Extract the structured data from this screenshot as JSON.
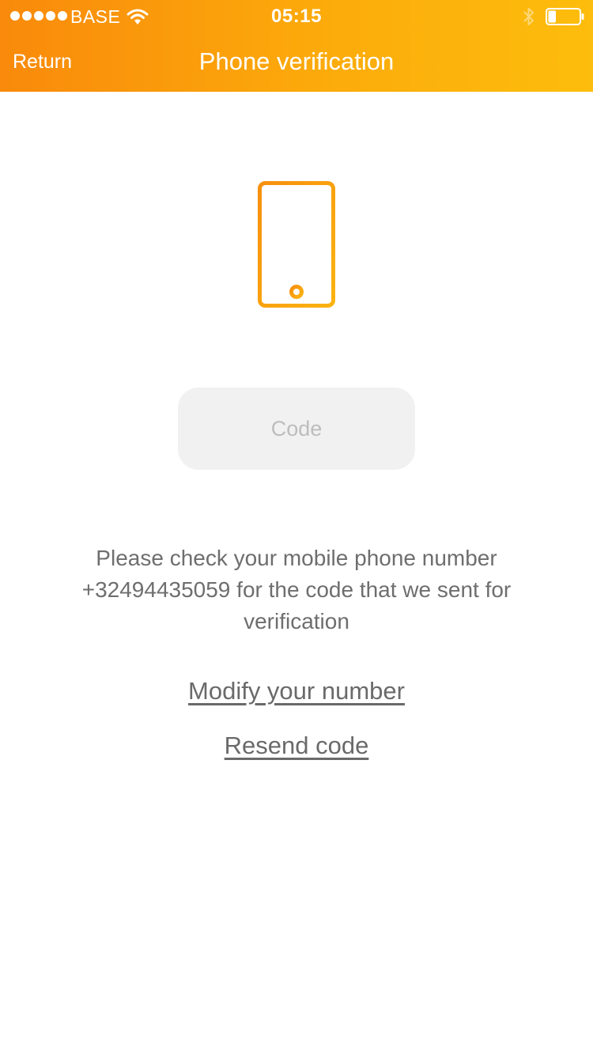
{
  "status_bar": {
    "carrier": "BASE",
    "time": "05:15",
    "battery_level": 0.25
  },
  "header": {
    "back_label": "Return",
    "title": "Phone verification"
  },
  "main": {
    "code_placeholder": "Code",
    "code_value": "",
    "instruction_line1": "Please check your mobile phone number",
    "instruction_line2": "+32494435059 for the code that we sent for",
    "instruction_line3": "verification",
    "modify_label": "Modify your number",
    "resend_label": "Resend code"
  },
  "colors": {
    "gradient_start": "#f98a0b",
    "gradient_end": "#fdbd0c",
    "icon_start": "#f7900d",
    "icon_end": "#fbb311",
    "link_text": "#6a6a6a"
  },
  "icons": [
    "signal-icon",
    "wifi-icon",
    "bluetooth-icon",
    "battery-icon",
    "smartphone-icon"
  ]
}
